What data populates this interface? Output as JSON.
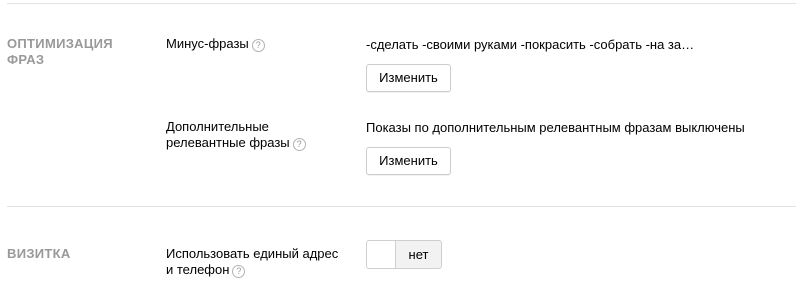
{
  "sections": [
    {
      "title_line1": "ОПТИМИЗАЦИЯ",
      "title_line2": "ФРАЗ",
      "rows": [
        {
          "label": "Минус-фразы",
          "value": "-сделать -своими руками -покрасить -собрать -на за…",
          "button": "Изменить"
        },
        {
          "label_line1": "Дополнительные",
          "label_line2": "релевантные фразы",
          "value": "Показы по дополнительным релевантным фразам выключены",
          "button": "Изменить"
        }
      ]
    },
    {
      "title": "ВИЗИТКА",
      "rows": [
        {
          "label_line1": "Использовать единый адрес",
          "label_line2": "и телефон",
          "toggle_label": "нет",
          "toggle_on": false
        }
      ]
    }
  ],
  "help_icon_glyph": "?"
}
